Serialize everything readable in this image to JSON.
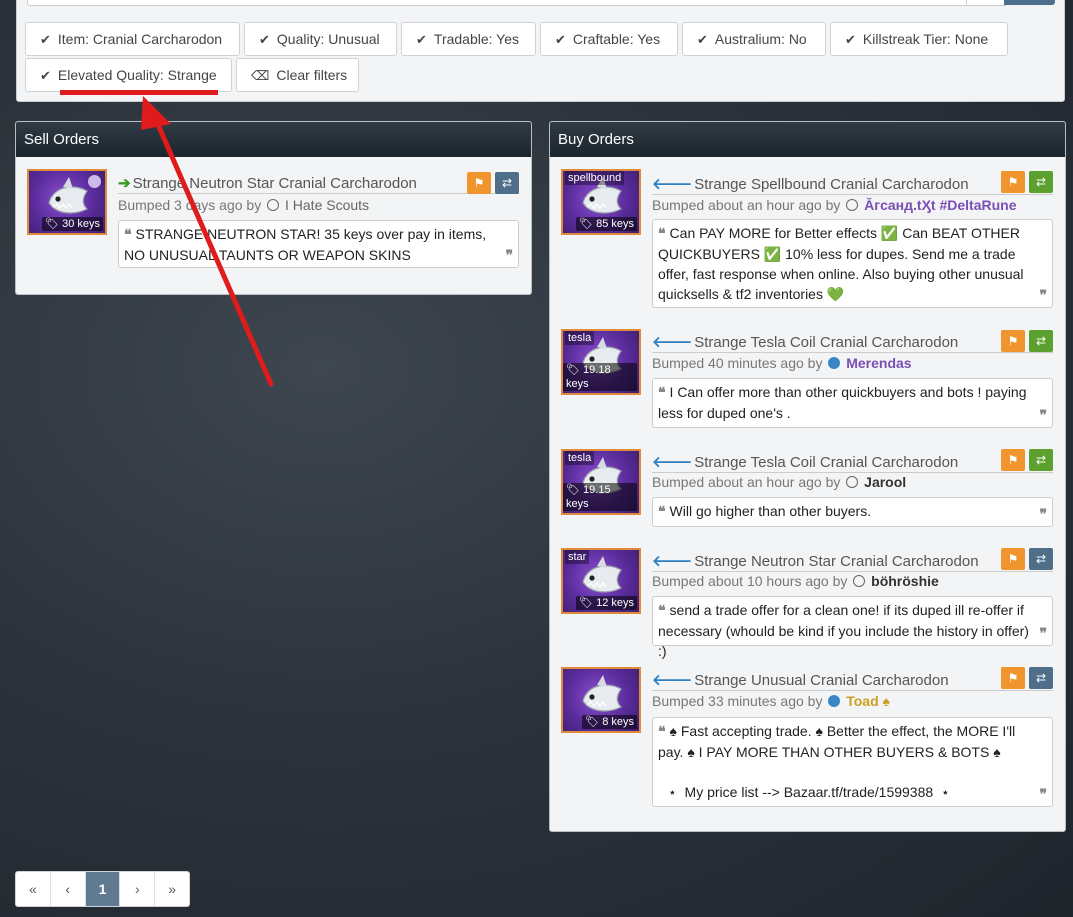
{
  "filters": [
    {
      "label": "Item: Cranial Carcharodon"
    },
    {
      "label": "Quality: Unusual"
    },
    {
      "label": "Tradable: Yes"
    },
    {
      "label": "Craftable: Yes"
    },
    {
      "label": "Australium: No"
    },
    {
      "label": "Killstreak Tier: None"
    },
    {
      "label": "Elevated Quality: Strange"
    }
  ],
  "clear_filters_label": "Clear filters",
  "sell": {
    "heading": "Sell Orders",
    "orders": [
      {
        "title": "Strange Neutron Star Cranial Carcharodon",
        "bumped": "Bumped 3 days ago by",
        "user": "I Hate Scouts",
        "price": "30 keys",
        "comment": "STRANGE NEUTRON STAR! 35 keys over pay in items, NO UNUSUAL TAUNTS OR WEAPON SKINS"
      }
    ]
  },
  "buy": {
    "heading": "Buy Orders",
    "orders": [
      {
        "tag": "spellbound",
        "price": "85 keys",
        "title": "Strange Spellbound Cranial Carcharodon",
        "bumped": "Bumped about an hour ago by",
        "user": "Ăгcaнд.tӼt #DeltaRune",
        "comment": "Can PAY MORE for Better effects ✅ Can BEAT OTHER QUICKBUYERS ✅ 10% less for dupes. Send me a trade offer, fast response when online. Also buying other unusual quicksells & tf2 inventories 💚"
      },
      {
        "tag": "tesla",
        "price": "19.18 keys",
        "title": "Strange Tesla Coil Cranial Carcharodon",
        "bumped": "Bumped 40 minutes ago by",
        "user": "Merendas",
        "comment": "I Can offer more than other quickbuyers and bots ! paying less for duped one's ."
      },
      {
        "tag": "tesla",
        "price": "19.15 keys",
        "title": "Strange Tesla Coil Cranial Carcharodon",
        "bumped": "Bumped about an hour ago by",
        "user": "Jarool",
        "comment": "Will go higher than other buyers."
      },
      {
        "tag": "star",
        "price": "12 keys",
        "title": "Strange Neutron Star Cranial Carcharodon",
        "bumped": "Bumped about 10 hours ago by",
        "user": "böhröshie",
        "comment": "send a trade offer for a clean one! if its duped ill re-offer if necessary (whould be kind if you include the history in offer) :)"
      },
      {
        "tag": "",
        "price": "8 keys",
        "title": "Strange Unusual Cranial Carcharodon",
        "bumped": "Bumped 33 minutes ago by",
        "user": "Toad ♠",
        "comment_line1": "♠ Fast accepting trade. ♠ Better the effect, the MORE I'll pay. ♠ I PAY MORE THAN OTHER BUYERS & BOTS ♠",
        "comment_line2": "⋆  My price list --> Bazaar.tf/trade/1599388  ⋆"
      }
    ]
  },
  "pagination": {
    "first": "«",
    "prev": "‹",
    "current": "1",
    "next": "›",
    "last": "»"
  },
  "colors": {
    "flag": "#f0952e",
    "trade_blue": "#4f6e8a",
    "trade_green": "#5ca12f",
    "annotation_red": "#e01b1b"
  }
}
